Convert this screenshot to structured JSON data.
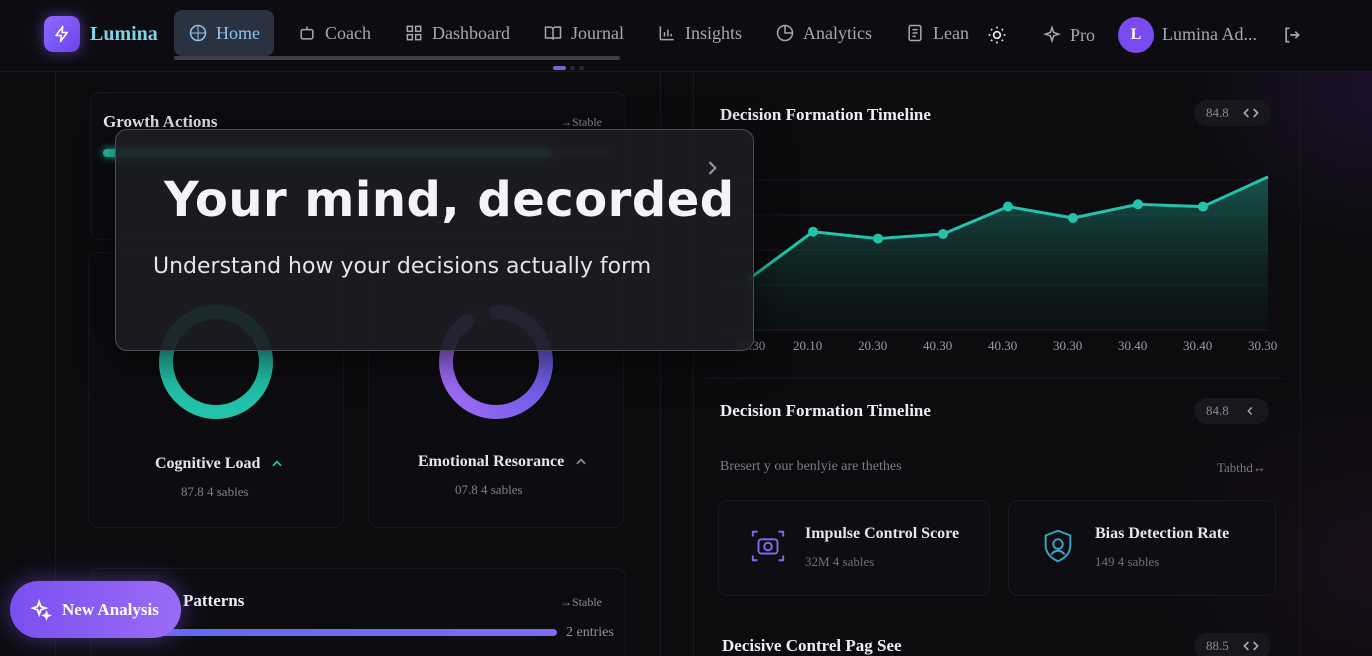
{
  "app": {
    "name": "Lumina"
  },
  "nav": {
    "items": [
      {
        "label": "Home",
        "icon": "compass-icon",
        "active": true
      },
      {
        "label": "Coach",
        "icon": "bot-icon",
        "active": false
      },
      {
        "label": "Dashboard",
        "icon": "grid-icon",
        "active": false
      },
      {
        "label": "Journal",
        "icon": "book-open-icon",
        "active": false
      },
      {
        "label": "Insights",
        "icon": "bar-chart-icon",
        "active": false
      },
      {
        "label": "Analytics",
        "icon": "pie-chart-icon",
        "active": false
      },
      {
        "label": "Lean",
        "icon": "notebook-icon",
        "active": false
      }
    ],
    "pro_label": "Pro",
    "user": {
      "initial": "L",
      "name": "Lumina Ad..."
    }
  },
  "overlay": {
    "title": "Your mind, decorded",
    "subtitle": "Understand how your decisions actually form"
  },
  "left": {
    "growth": {
      "title": "Growth Actions",
      "status": "→Stable",
      "progress": 0.88,
      "color": "#2bbfa8"
    },
    "rings": [
      {
        "label": "Cognitive Load",
        "sub": "87.8 4 sables",
        "color": "#23c2ab",
        "value": 1.0
      },
      {
        "label": "Emotional Resorance",
        "sub": "07.8 4 sables",
        "color": "#8f63f2",
        "value": 0.9
      }
    ],
    "patterns": {
      "title": "Patterns",
      "status": "→Stable",
      "count": "2 entries",
      "color": "#7c6cf0"
    }
  },
  "right": {
    "timeline": {
      "title": "Decision Formation Timeline",
      "badge": "84.8"
    },
    "timeline2": {
      "title": "Decision Formation Timeline",
      "badge": "84.8",
      "caption": "Bresert y our benlyie are thethes",
      "link": "Tabthd↔"
    },
    "metrics": [
      {
        "title": "Impulse Control Score",
        "sub": "32M 4 sables",
        "icon": "camera-scan-icon"
      },
      {
        "title": "Bias Detection Rate",
        "sub": "149 4 sables",
        "icon": "shield-face-icon"
      }
    ],
    "bottom": {
      "title": "Decisive Contrel Pag See",
      "badge": "88.5"
    }
  },
  "fab": {
    "label": "New Analysis"
  },
  "chart_data": {
    "type": "area",
    "title": "Decision Formation Timeline",
    "x": [
      "20.30",
      "20.10",
      "20.30",
      "40.30",
      "40.30",
      "30.30",
      "30.40",
      "30.40",
      "30.30"
    ],
    "values": [
      52,
      73,
      70,
      72,
      84,
      79,
      85,
      84,
      97
    ],
    "color": "#23c2ab"
  }
}
